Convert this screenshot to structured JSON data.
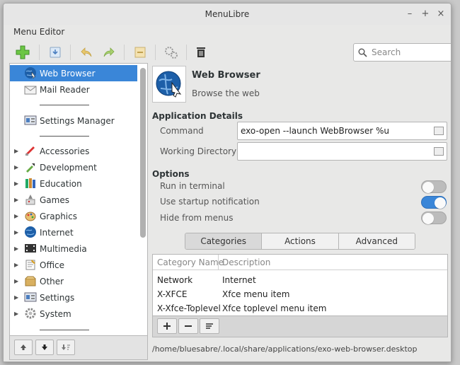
{
  "window": {
    "title": "MenuLibre",
    "controls": [
      "–",
      "+",
      "×"
    ]
  },
  "menubar": {
    "menu_editor": "Menu Editor"
  },
  "search": {
    "placeholder": "Search"
  },
  "sidebar": {
    "items": [
      {
        "label": "Web Browser",
        "icon": "web-browser-icon",
        "selected": true
      },
      {
        "label": "Mail Reader",
        "icon": "mail-icon"
      },
      {
        "label": "Settings Manager",
        "icon": "settings-manager-icon"
      },
      {
        "label": "Accessories",
        "icon": "accessories-icon"
      },
      {
        "label": "Development",
        "icon": "development-icon"
      },
      {
        "label": "Education",
        "icon": "education-icon"
      },
      {
        "label": "Games",
        "icon": "games-icon"
      },
      {
        "label": "Graphics",
        "icon": "graphics-icon"
      },
      {
        "label": "Internet",
        "icon": "internet-icon"
      },
      {
        "label": "Multimedia",
        "icon": "multimedia-icon"
      },
      {
        "label": "Office",
        "icon": "office-icon"
      },
      {
        "label": "Other",
        "icon": "other-icon"
      },
      {
        "label": "Settings",
        "icon": "settings-icon"
      },
      {
        "label": "System",
        "icon": "system-icon"
      }
    ]
  },
  "app": {
    "name": "Web Browser",
    "comment": "Browse the web"
  },
  "details": {
    "section": "Application Details",
    "command_label": "Command",
    "command_value": "exo-open --launch WebBrowser %u",
    "workdir_label": "Working Directory",
    "workdir_value": ""
  },
  "options": {
    "section": "Options",
    "run_in_terminal": {
      "label": "Run in terminal",
      "on": false
    },
    "startup_notification": {
      "label": "Use startup notification",
      "on": true
    },
    "hide_from_menus": {
      "label": "Hide from menus",
      "on": false
    }
  },
  "tabs": [
    {
      "label": "Categories",
      "active": true
    },
    {
      "label": "Actions"
    },
    {
      "label": "Advanced"
    }
  ],
  "categories": {
    "headers": [
      "Category Name",
      "Description"
    ],
    "rows": [
      [
        "Network",
        "Internet"
      ],
      [
        "X-XFCE",
        "Xfce menu item"
      ],
      [
        "X-Xfce-Toplevel",
        "Xfce toplevel menu item"
      ]
    ]
  },
  "status": {
    "path": "/home/bluesabre/.local/share/applications/exo-web-browser.desktop"
  },
  "colors": {
    "accent": "#3a86d8",
    "toggle_off": "#bcbcbc"
  }
}
